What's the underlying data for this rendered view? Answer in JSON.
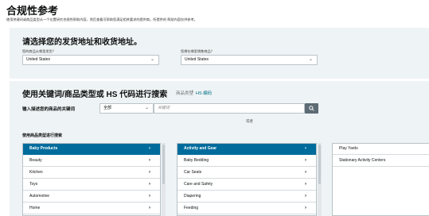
{
  "header": {
    "title": "合规性参考",
    "subtitle": "使用关键词或商品类型从一个位置研究合规性帮助内容，然后查看可帮助您满足相关要求的提供商。所提供的 帮助内容仅供参考。"
  },
  "address": {
    "heading": "请选择您的发货地址和收货地址。",
    "ship_from_label": "您的商品从哪里发货？",
    "ship_from_value": "United States",
    "ship_to_label": "您想在哪里销售商品？",
    "ship_to_value": "United States"
  },
  "search": {
    "heading": "使用关键词/商品类型或 HS 代码进行搜索",
    "mode_product_type": "商品类型",
    "mode_separator": "|",
    "mode_hs_code": "HS 编码",
    "keyword_label": "输入描述您的商品的关键词",
    "category_value": "全部",
    "keyword_placeholder": "关键词",
    "search_icon": "magnifier-icon",
    "or_label": "或者",
    "browse_label": "使用商品类型进行搜索"
  },
  "categories": {
    "level1": [
      "Baby Products",
      "Beauty",
      "Kitchen",
      "Toys",
      "Automotive",
      "Home"
    ],
    "level2": [
      "Activity and Gear",
      "Baby Bedding",
      "Car Seats",
      "Care and Safety",
      "Diapering",
      "Feeding"
    ],
    "level3": [
      "Play Yards",
      "Stationary Activity Centers"
    ],
    "selected_level1": "Baby Products",
    "selected_level2": "Activity and Gear"
  },
  "colors": {
    "selected_row": "#006c9c",
    "panel_bg": "#eef3f5",
    "link": "#007185",
    "search_button": "#5d6b75"
  }
}
